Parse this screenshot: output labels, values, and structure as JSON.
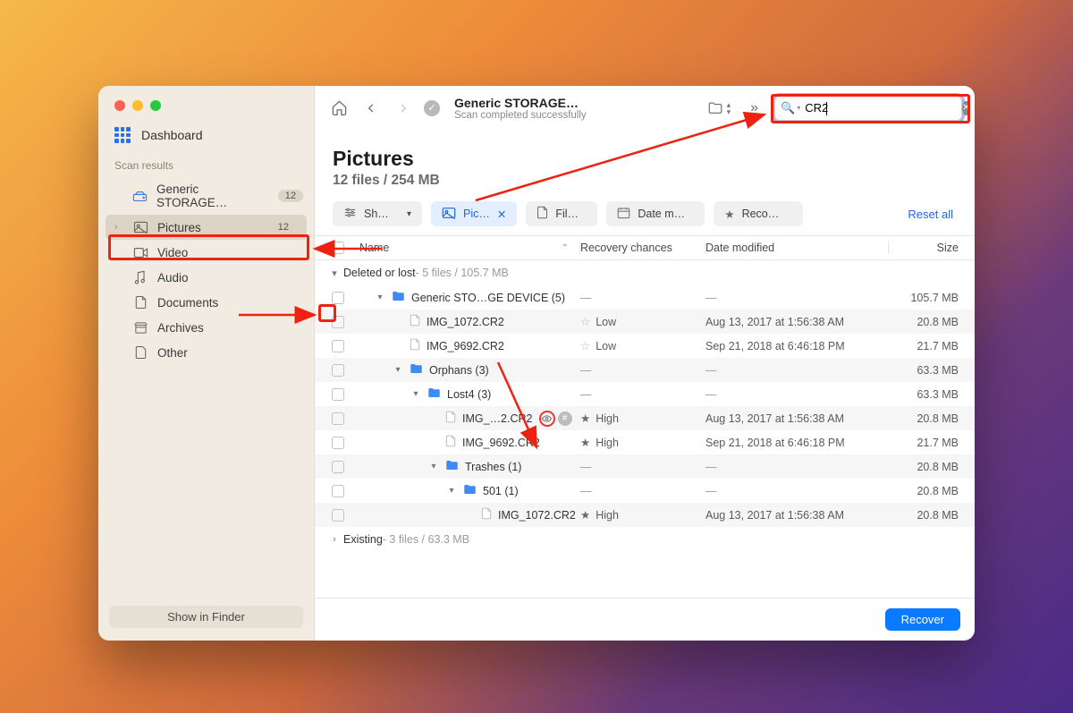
{
  "sidebar": {
    "dashboard": "Dashboard",
    "section_label": "Scan results",
    "show_in_finder": "Show in Finder",
    "items": [
      {
        "label": "Generic STORAGE…",
        "badge": "12",
        "type": "storage"
      },
      {
        "label": "Pictures",
        "badge": "12",
        "type": "pictures",
        "selected": true,
        "chev": true
      },
      {
        "label": "Video",
        "type": "video"
      },
      {
        "label": "Audio",
        "type": "audio"
      },
      {
        "label": "Documents",
        "type": "documents"
      },
      {
        "label": "Archives",
        "type": "archives"
      },
      {
        "label": "Other",
        "type": "other"
      }
    ]
  },
  "toolbar": {
    "title": "Generic STORAGE…",
    "subtitle": "Scan completed successfully",
    "search_value": "CR2"
  },
  "page": {
    "title": "Pictures",
    "subtitle": "12 files / 254 MB"
  },
  "filters": {
    "show": "Sh…",
    "pictures": "Pic…",
    "file": "Fil…",
    "date": "Date m…",
    "recovery": "Reco…",
    "reset": "Reset all"
  },
  "columns": {
    "name": "Name",
    "rc": "Recovery chances",
    "dm": "Date modified",
    "sz": "Size"
  },
  "groups": [
    {
      "chev": "▾",
      "name": "Deleted or lost",
      "meta": " - 5 files / 105.7 MB"
    },
    {
      "chev": "›",
      "name": "Existing",
      "meta": " - 3 files / 63.3 MB"
    }
  ],
  "rows": [
    {
      "indent": 0,
      "chev": "▾",
      "icon": "folder",
      "name": "Generic STO…GE DEVICE (5)",
      "rc": "—",
      "dm": "—",
      "sz": "105.7 MB",
      "alt": false
    },
    {
      "indent": 1,
      "chev": "",
      "icon": "file",
      "name": "IMG_1072.CR2",
      "rc": "Low",
      "rcStar": "low",
      "dm": "Aug 13, 2017 at 1:56:38 AM",
      "sz": "20.8 MB",
      "alt": true
    },
    {
      "indent": 1,
      "chev": "",
      "icon": "file",
      "name": "IMG_9692.CR2",
      "rc": "Low",
      "rcStar": "low",
      "dm": "Sep 21, 2018 at 6:46:18 PM",
      "sz": "21.7 MB",
      "alt": false
    },
    {
      "indent": 1,
      "chev": "▾",
      "icon": "folder",
      "name": "Orphans (3)",
      "rc": "—",
      "dm": "—",
      "sz": "63.3 MB",
      "alt": true
    },
    {
      "indent": 2,
      "chev": "▾",
      "icon": "folder",
      "name": "Lost4 (3)",
      "rc": "—",
      "dm": "—",
      "sz": "63.3 MB",
      "alt": false
    },
    {
      "indent": 3,
      "chev": "",
      "icon": "file",
      "name": "IMG_…2.CR2",
      "eye": true,
      "rc": "High",
      "rcStar": "high",
      "dm": "Aug 13, 2017 at 1:56:38 AM",
      "sz": "20.8 MB",
      "alt": true
    },
    {
      "indent": 3,
      "chev": "",
      "icon": "file",
      "name": "IMG_9692.CR2",
      "rc": "High",
      "rcStar": "high",
      "dm": "Sep 21, 2018 at 6:46:18 PM",
      "sz": "21.7 MB",
      "alt": false
    },
    {
      "indent": 3,
      "chev": "▾",
      "icon": "folder",
      "name": "Trashes (1)",
      "rc": "—",
      "dm": "—",
      "sz": "20.8 MB",
      "alt": true
    },
    {
      "indent": 4,
      "chev": "▾",
      "icon": "folder",
      "name": "501 (1)",
      "rc": "—",
      "dm": "—",
      "sz": "20.8 MB",
      "alt": false
    },
    {
      "indent": 5,
      "chev": "",
      "icon": "file",
      "name": "IMG_1072.CR2",
      "rc": "High",
      "rcStar": "high",
      "dm": "Aug 13, 2017 at 1:56:38 AM",
      "sz": "20.8 MB",
      "alt": true
    }
  ],
  "recover": "Recover"
}
